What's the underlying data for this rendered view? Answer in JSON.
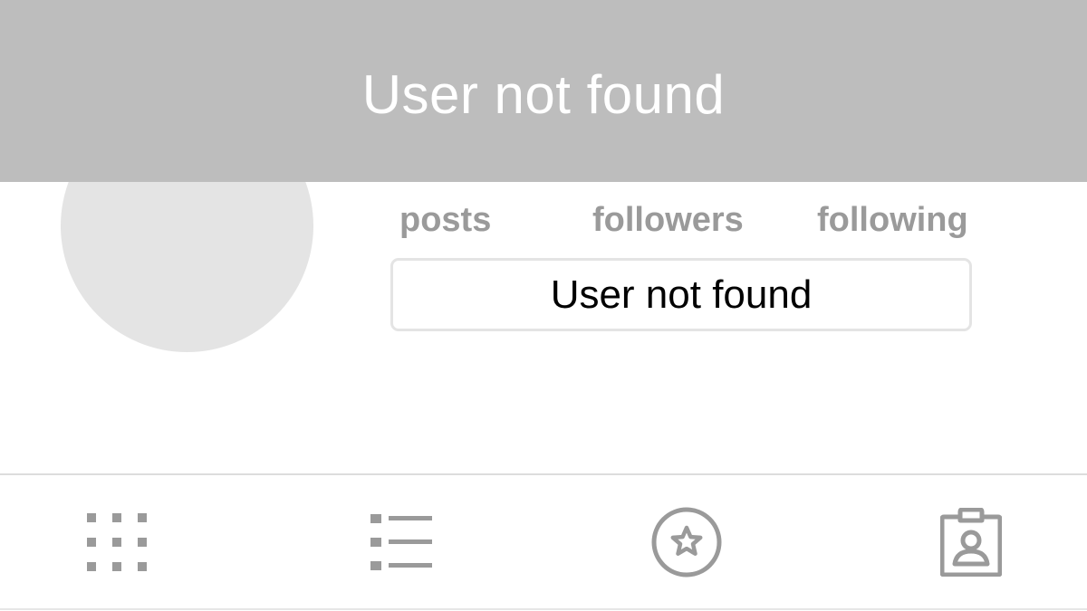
{
  "header": {
    "title": "User not found"
  },
  "profile": {
    "stats": {
      "posts_label": "posts",
      "followers_label": "followers",
      "following_label": "following"
    },
    "button_label": "User not found"
  },
  "tabs": [
    {
      "icon": "grid-icon"
    },
    {
      "icon": "list-icon"
    },
    {
      "icon": "star-circle-icon"
    },
    {
      "icon": "contact-badge-icon"
    }
  ],
  "colors": {
    "header_background": "#bdbdbd",
    "header_text": "#ffffff",
    "stat_text": "#9a9a9a",
    "avatar_placeholder": "#e4e4e4",
    "icon_color": "#9a9a9a"
  }
}
